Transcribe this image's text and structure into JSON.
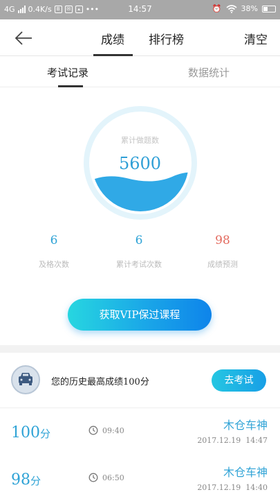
{
  "status_bar": {
    "network": "4G",
    "speed": "0.4K/s",
    "time": "14:57",
    "battery": "38%"
  },
  "nav": {
    "tabs": [
      "成绩",
      "排行榜"
    ],
    "clear_label": "清空"
  },
  "subtabs": [
    "考试记录",
    "数据统计"
  ],
  "gauge": {
    "label": "累计做题数",
    "value": "5600"
  },
  "stats": [
    {
      "value": "6",
      "label": "及格次数"
    },
    {
      "value": "6",
      "label": "累计考试次数"
    },
    {
      "value": "98",
      "label": "成绩预测"
    }
  ],
  "vip_button": "获取VIP保过课程",
  "best": {
    "text": "您的历史最高成绩100分",
    "button": "去考试"
  },
  "records": [
    {
      "score": "100",
      "unit": "分",
      "duration": "09:40",
      "name": "木仓车神",
      "date": "2017.12.19",
      "time": "14:47"
    },
    {
      "score": "98",
      "unit": "分",
      "duration": "06:50",
      "name": "木仓车神",
      "date": "2017.12.19",
      "time": "14:40"
    }
  ],
  "colors": {
    "accent": "#2fa3d6",
    "prediction": "#e36a5e",
    "status_bar": "#a8a8a8"
  }
}
